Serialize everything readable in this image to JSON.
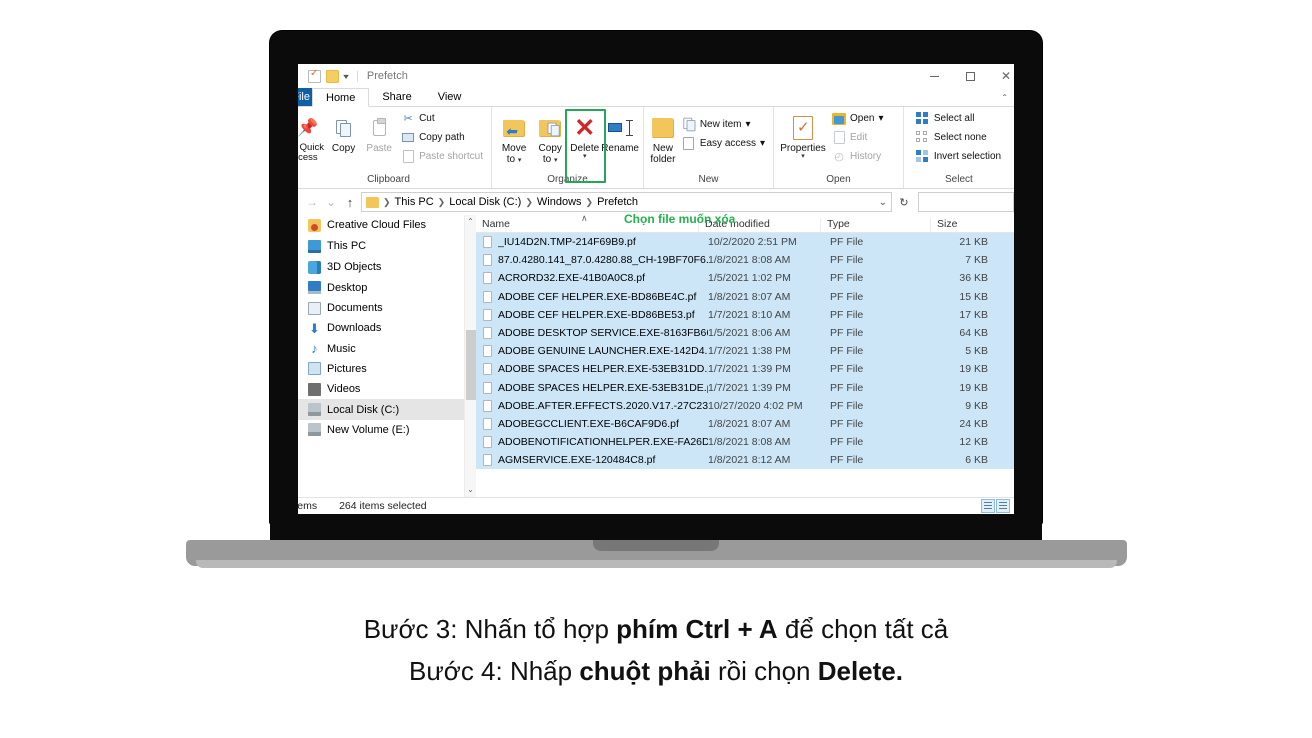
{
  "window": {
    "title": "Prefetch",
    "quick_access_icons": [
      "properties-check-icon",
      "new-folder-icon",
      "customize-caret-icon"
    ],
    "controls": {
      "minimize": "—",
      "maximize": "▢",
      "close": "✕"
    }
  },
  "ribbon": {
    "tabs": [
      {
        "label": "File",
        "active": false
      },
      {
        "label": "Home",
        "active": true
      },
      {
        "label": "Share",
        "active": false
      },
      {
        "label": "View",
        "active": false
      }
    ],
    "groups": [
      {
        "name": "Clipboard",
        "label": "Clipboard",
        "big_buttons": [
          {
            "label": "o Quick\ncess",
            "icon": "pin-icon",
            "disabled": false
          },
          {
            "label": "Copy",
            "icon": "copy-icon",
            "disabled": false
          },
          {
            "label": "Paste",
            "icon": "paste-icon",
            "disabled": true
          }
        ],
        "small_buttons": [
          {
            "label": "Cut",
            "icon": "scissors-icon",
            "disabled": false
          },
          {
            "label": "Copy path",
            "icon": "copy-path-icon",
            "disabled": false
          },
          {
            "label": "Paste shortcut",
            "icon": "paste-shortcut-icon",
            "disabled": true
          }
        ]
      },
      {
        "name": "Organize",
        "label": "Organize",
        "big_buttons": [
          {
            "label": "Move\nto",
            "icon": "move-to-icon",
            "caret": true
          },
          {
            "label": "Copy\nto",
            "icon": "copy-to-icon",
            "caret": true
          },
          {
            "label": "Delete",
            "icon": "delete-x-icon",
            "caret": true,
            "highlighted": true
          },
          {
            "label": "Rename",
            "icon": "rename-icon",
            "caret": false
          }
        ]
      },
      {
        "name": "New",
        "label": "New",
        "big_buttons": [
          {
            "label": "New\nfolder",
            "icon": "new-folder-icon"
          }
        ],
        "small_buttons": [
          {
            "label": "New item",
            "icon": "new-item-icon",
            "caret": true
          },
          {
            "label": "Easy access",
            "icon": "easy-access-icon",
            "caret": true
          }
        ]
      },
      {
        "name": "Open",
        "label": "Open",
        "big_buttons": [
          {
            "label": "Properties",
            "icon": "properties-icon",
            "caret": true
          }
        ],
        "small_buttons": [
          {
            "label": "Open",
            "icon": "open-folder-icon",
            "caret": true,
            "disabled": false
          },
          {
            "label": "Edit",
            "icon": "edit-icon",
            "disabled": true
          },
          {
            "label": "History",
            "icon": "history-icon",
            "disabled": true
          }
        ]
      },
      {
        "name": "Select",
        "label": "Select",
        "small_buttons": [
          {
            "label": "Select all",
            "icon": "select-all-icon"
          },
          {
            "label": "Select none",
            "icon": "select-none-icon"
          },
          {
            "label": "Invert selection",
            "icon": "invert-selection-icon"
          }
        ]
      }
    ]
  },
  "address_bar": {
    "back": "→",
    "forward": "∨",
    "up": "↑",
    "breadcrumbs": [
      "This PC",
      "Local Disk (C:)",
      "Windows",
      "Prefetch"
    ],
    "dropdown_caret": "∨",
    "refresh": "↻",
    "search_value": "",
    "search_placeholder": ""
  },
  "nav_pane": {
    "items": [
      {
        "label": "Creative Cloud Files",
        "icon": "creative-cloud-icon",
        "selected": false
      },
      {
        "label": "This PC",
        "icon": "this-pc-icon",
        "selected": false
      },
      {
        "label": "3D Objects",
        "icon": "3d-objects-icon",
        "selected": false
      },
      {
        "label": "Desktop",
        "icon": "desktop-icon",
        "selected": false
      },
      {
        "label": "Documents",
        "icon": "documents-icon",
        "selected": false
      },
      {
        "label": "Downloads",
        "icon": "downloads-icon",
        "selected": false
      },
      {
        "label": "Music",
        "icon": "music-icon",
        "selected": false
      },
      {
        "label": "Pictures",
        "icon": "pictures-icon",
        "selected": false
      },
      {
        "label": "Videos",
        "icon": "videos-icon",
        "selected": false
      },
      {
        "label": "Local Disk (C:)",
        "icon": "disk-icon",
        "selected": true
      },
      {
        "label": "New Volume (E:)",
        "icon": "disk-icon",
        "selected": false
      }
    ]
  },
  "file_list": {
    "annotation": "Chọn file muốn xóa",
    "annotation_color": "#21b24b",
    "columns": [
      "Name",
      "Date modified",
      "Type",
      "Size"
    ],
    "sort_indicator": "∧",
    "rows": [
      {
        "name": "_IU14D2N.TMP-214F69B9.pf",
        "date": "10/2/2020 2:51 PM",
        "type": "PF File",
        "size": "21 KB",
        "selected": true
      },
      {
        "name": "87.0.4280.141_87.0.4280.88_CH-19BF70F6....",
        "date": "1/8/2021 8:08 AM",
        "type": "PF File",
        "size": "7 KB",
        "selected": true
      },
      {
        "name": "ACRORD32.EXE-41B0A0C8.pf",
        "date": "1/5/2021 1:02 PM",
        "type": "PF File",
        "size": "36 KB",
        "selected": true
      },
      {
        "name": "ADOBE CEF HELPER.EXE-BD86BE4C.pf",
        "date": "1/8/2021 8:07 AM",
        "type": "PF File",
        "size": "15 KB",
        "selected": true
      },
      {
        "name": "ADOBE CEF HELPER.EXE-BD86BE53.pf",
        "date": "1/7/2021 8:10 AM",
        "type": "PF File",
        "size": "17 KB",
        "selected": true
      },
      {
        "name": "ADOBE DESKTOP SERVICE.EXE-8163FB66.pf",
        "date": "1/5/2021 8:06 AM",
        "type": "PF File",
        "size": "64 KB",
        "selected": true
      },
      {
        "name": "ADOBE GENUINE LAUNCHER.EXE-142D4...",
        "date": "1/7/2021 1:38 PM",
        "type": "PF File",
        "size": "5 KB",
        "selected": true
      },
      {
        "name": "ADOBE SPACES HELPER.EXE-53EB31DD.pf",
        "date": "1/7/2021 1:39 PM",
        "type": "PF File",
        "size": "19 KB",
        "selected": true
      },
      {
        "name": "ADOBE SPACES HELPER.EXE-53EB31DE.pf",
        "date": "1/7/2021 1:39 PM",
        "type": "PF File",
        "size": "19 KB",
        "selected": true
      },
      {
        "name": "ADOBE.AFTER.EFFECTS.2020.V17.-27C23...",
        "date": "10/27/2020 4:02 PM",
        "type": "PF File",
        "size": "9 KB",
        "selected": true
      },
      {
        "name": "ADOBEGCCLIENT.EXE-B6CAF9D6.pf",
        "date": "1/8/2021 8:07 AM",
        "type": "PF File",
        "size": "24 KB",
        "selected": true
      },
      {
        "name": "ADOBENOTIFICATIONHELPER.EXE-FA26D...",
        "date": "1/8/2021 8:08 AM",
        "type": "PF File",
        "size": "12 KB",
        "selected": true
      },
      {
        "name": "AGMSERVICE.EXE-120484C8.pf",
        "date": "1/8/2021 8:12 AM",
        "type": "PF File",
        "size": "6 KB",
        "selected": true
      }
    ]
  },
  "status_bar": {
    "items_text": "items",
    "selected_text": "264 items selected",
    "view_details_icon": "details-view-icon",
    "view_tiles_icon": "tiles-view-icon"
  },
  "caption": {
    "line1_part1": "Bước 3",
    "line1_part2": ": Nhấn tổ hợp ",
    "line1_bold": "phím Ctrl + A",
    "line1_part3": " để chọn tất cả",
    "line2_part1": "Bước 4: Nhấp ",
    "line2_bold1": "chuột phải",
    "line2_part2": " rồi chọn ",
    "line2_bold2": "Delete."
  },
  "colors": {
    "selection_blue": "#cce6f7",
    "accent_blue": "#0e5fa4",
    "highlight_green": "#26a65b",
    "annotation_green": "#21b24b",
    "delete_red": "#cf2727"
  }
}
